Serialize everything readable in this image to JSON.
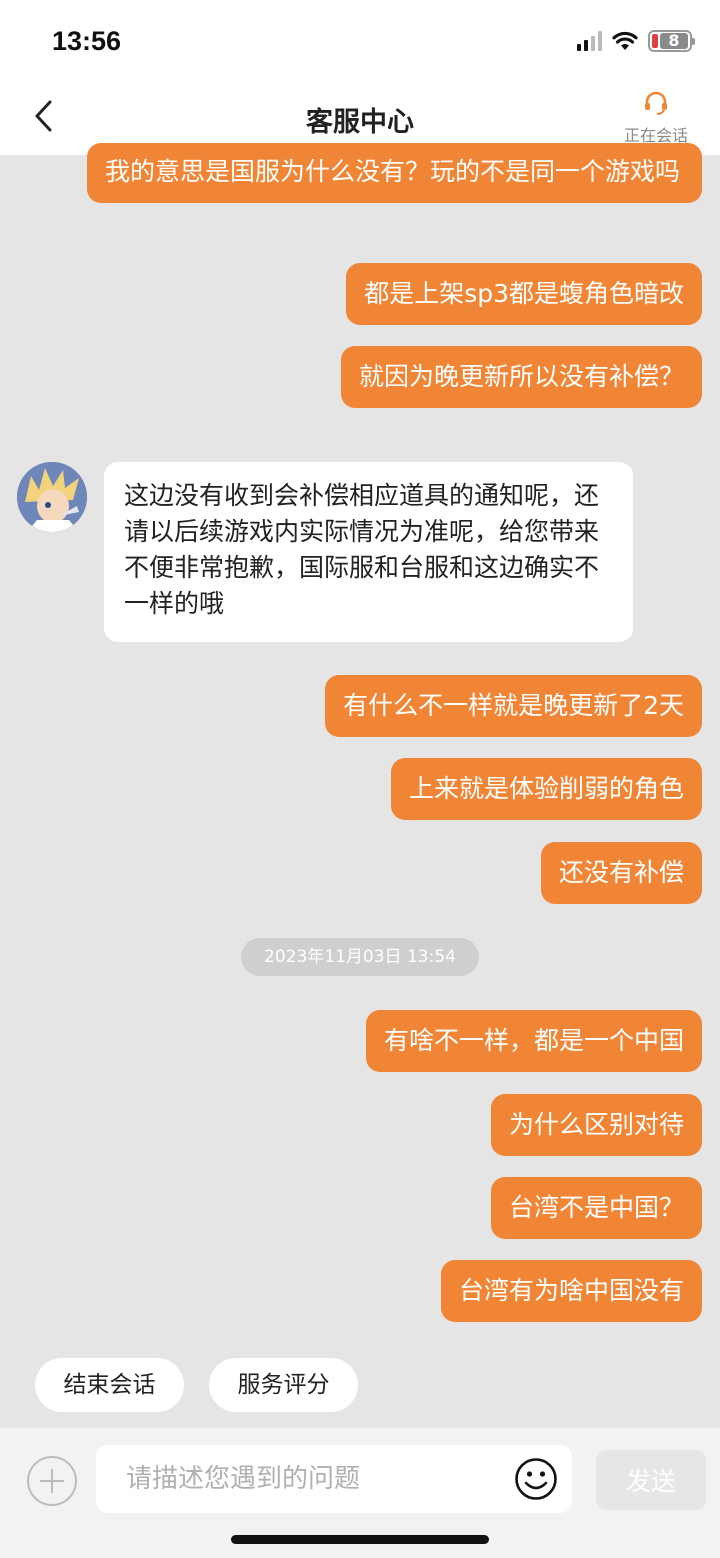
{
  "status_bar": {
    "time": "13:56",
    "battery_level": "8"
  },
  "nav": {
    "title": "客服中心",
    "session_label": "正在会话"
  },
  "messages": [
    {
      "from": "user",
      "text": "我的意思是国服为什么没有？玩的不是同一个游戏吗"
    },
    {
      "from": "user",
      "text": "都是上架sp3都是蝮角色暗改"
    },
    {
      "from": "user",
      "text": "就因为晚更新所以没有补偿？"
    },
    {
      "from": "agent",
      "text": "这边没有收到会补偿相应道具的通知呢，还请以后续游戏内实际情况为准呢，给您带来不便非常抱歉，国际服和台服和这边确实不一样的哦"
    },
    {
      "from": "user",
      "text": "有什么不一样就是晚更新了2天"
    },
    {
      "from": "user",
      "text": "上来就是体验削弱的角色"
    },
    {
      "from": "user",
      "text": "还没有补偿"
    },
    {
      "from": "user",
      "text": "有啥不一样，都是一个中国"
    },
    {
      "from": "user",
      "text": "为什么区别对待"
    },
    {
      "from": "user",
      "text": "台湾不是中国？"
    },
    {
      "from": "user",
      "text": "台湾有为啥中国没有"
    }
  ],
  "timestamp": "2023年11月03日 13:54",
  "quick_actions": [
    "结束会话",
    "服务评分"
  ],
  "input": {
    "placeholder": "请描述您遇到的问题",
    "send_label": "发送"
  },
  "colors": {
    "user_bubble": "#f08536",
    "background": "#e5e5e5",
    "accent": "#f08536"
  }
}
